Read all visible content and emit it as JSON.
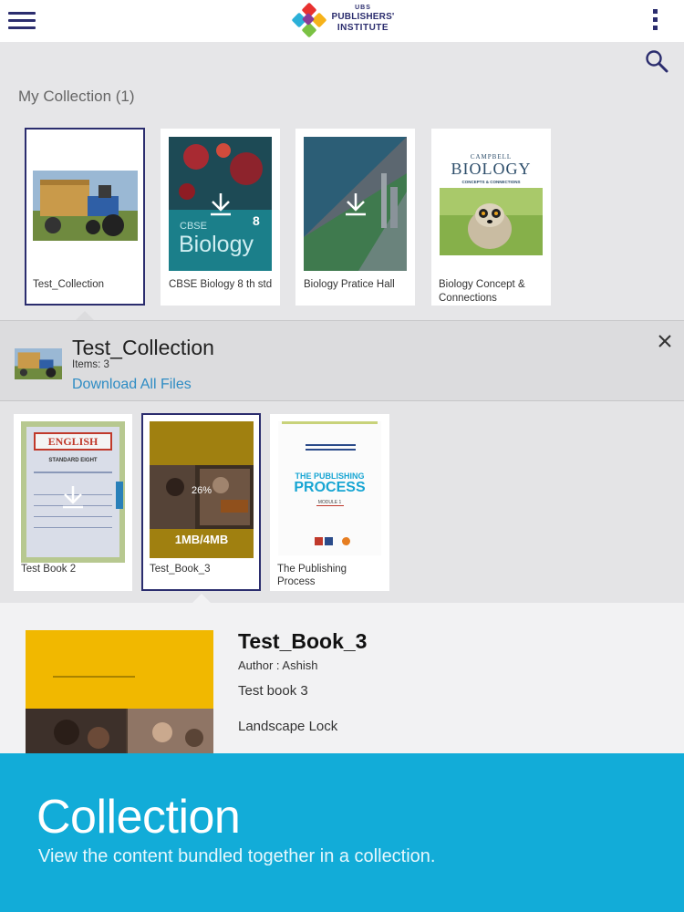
{
  "header": {
    "logo": {
      "ubs": "UBS",
      "line1": "PUBLISHERS'",
      "line2": "INSTITUTE"
    }
  },
  "collection_section": {
    "title": "My Collection (1)",
    "items": [
      {
        "label": "Test_Collection",
        "selected": true
      },
      {
        "label": "CBSE Biology 8 th std",
        "cover_title": "Biology",
        "cover_sub": "CBSE",
        "cover_badge": "8"
      },
      {
        "label": "Biology Pratice Hall"
      },
      {
        "label_line1": "Biology Concept &",
        "label_line2": "Connections",
        "cover_brand": "CAMPBELL",
        "cover_title": "BIOLOGY",
        "cover_sub": "CONCEPTS & CONNECTIONS"
      }
    ]
  },
  "collection_detail": {
    "title": "Test_Collection",
    "items_count": "Items: 3",
    "download_all": "Download All Files"
  },
  "books": [
    {
      "label": "Test Book 2",
      "cover_title": "ENGLISH",
      "cover_sub": "STANDARD EIGHT"
    },
    {
      "label": "Test_Book_3",
      "selected": true,
      "progress_percent": "26%",
      "progress_fraction": 0.26,
      "size_text": "1MB/4MB"
    },
    {
      "label_line1": "The Publishing",
      "label_line2": "Process",
      "cover_line1": "THE PUBLISHING",
      "cover_line2": "PROCESS",
      "cover_module": "MODULE 1"
    }
  ],
  "book_detail": {
    "title": "Test_Book_3",
    "author": "Author : Ashish",
    "description": "Test book 3",
    "lock": "Landscape Lock"
  },
  "banner": {
    "title": "Collection",
    "subtitle": "View the content bundled together in a collection."
  },
  "colors": {
    "brand_navy": "#2b2d6e",
    "link_blue": "#2e8cc4",
    "banner_cyan": "#12acd8",
    "cover_yellow": "#f1b800"
  }
}
